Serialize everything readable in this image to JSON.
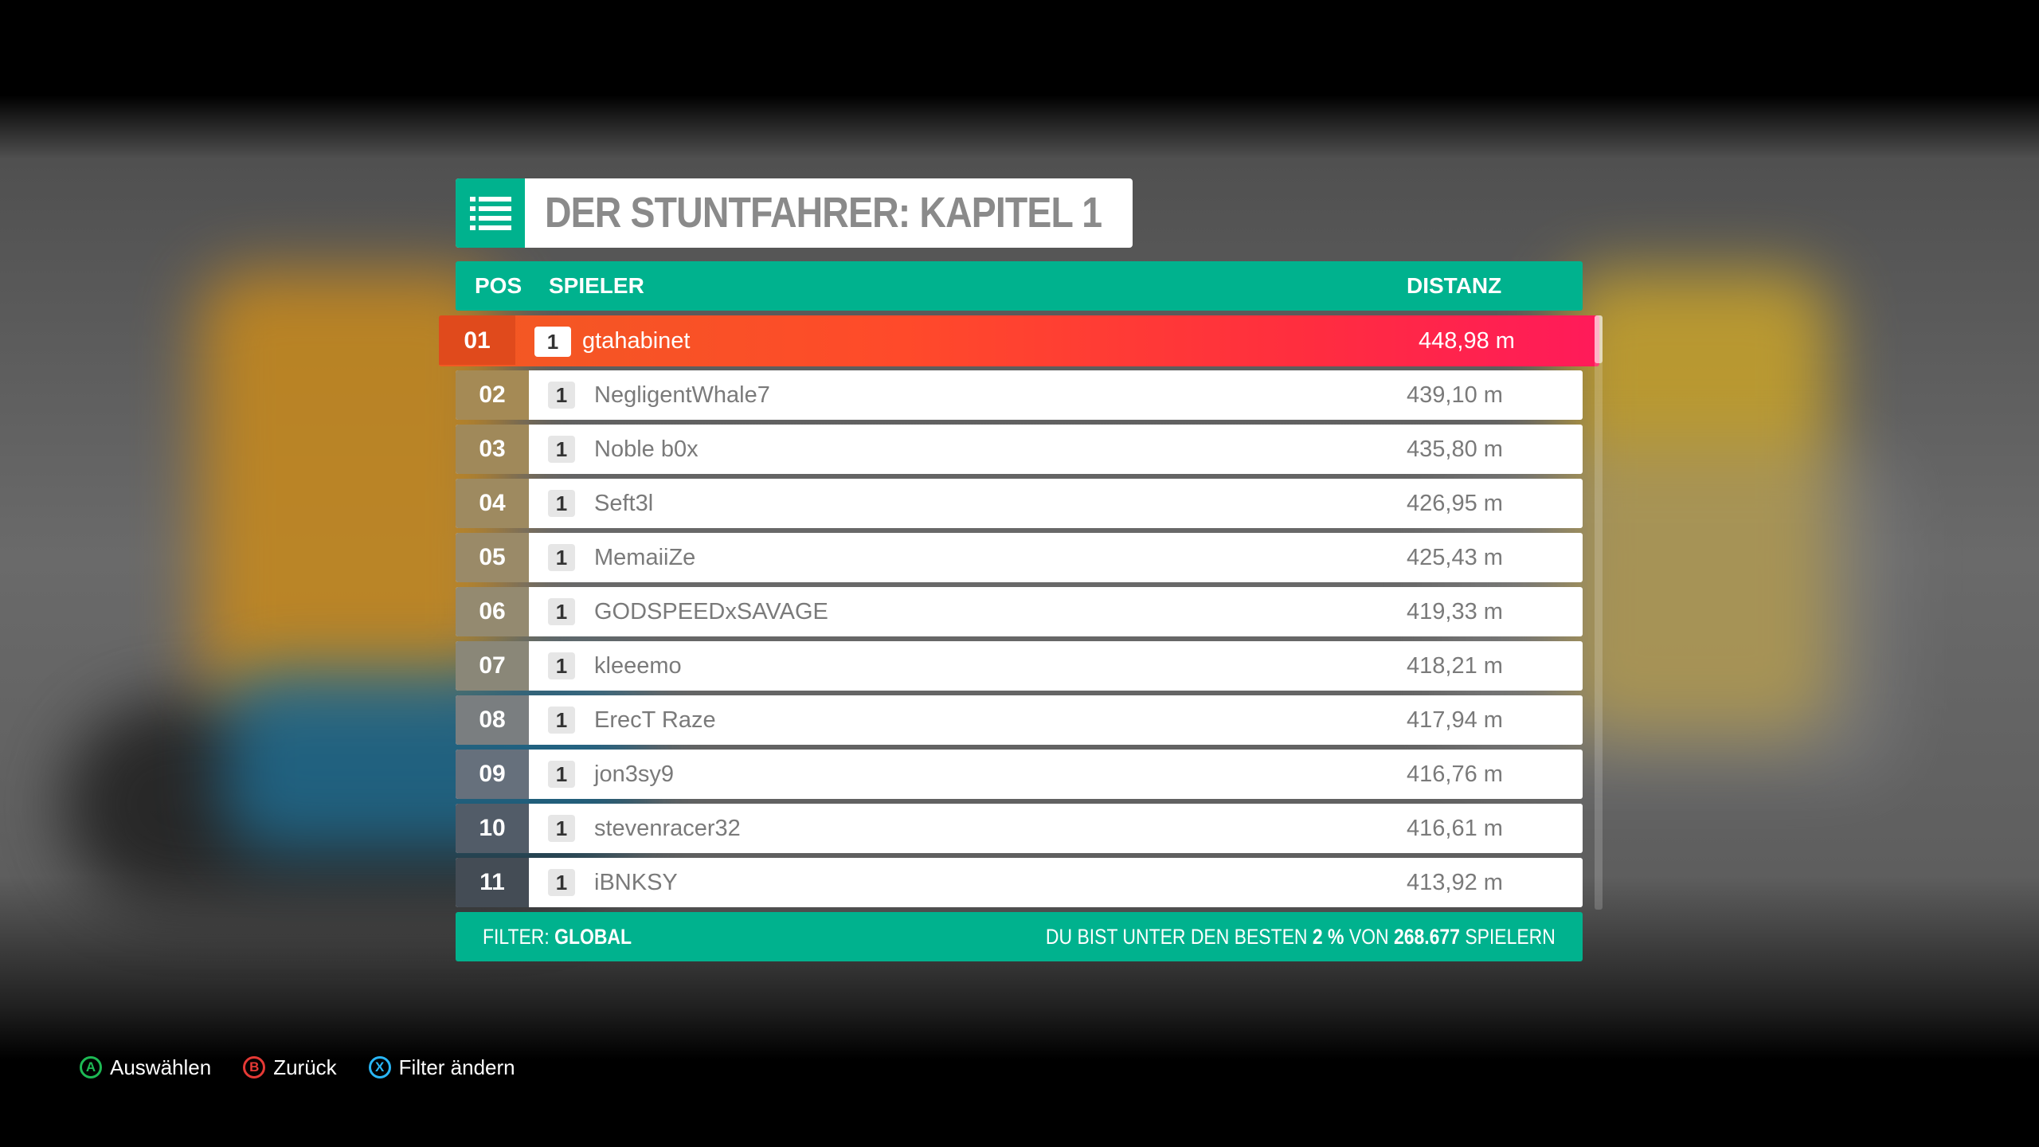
{
  "title": "DER STUNTFAHRER: KAPITEL 1",
  "title_icon": "list-icon",
  "columns": {
    "pos": "POS",
    "player": "SPIELER",
    "distance": "DISTANZ"
  },
  "rows": [
    {
      "pos": "01",
      "rank": "1",
      "player": "gtahabinet",
      "distance": "448,98 m",
      "highlighted": true
    },
    {
      "pos": "02",
      "rank": "1",
      "player": "NegligentWhale7",
      "distance": "439,10 m"
    },
    {
      "pos": "03",
      "rank": "1",
      "player": "Noble b0x",
      "distance": "435,80 m"
    },
    {
      "pos": "04",
      "rank": "1",
      "player": "Seft3l",
      "distance": "426,95 m"
    },
    {
      "pos": "05",
      "rank": "1",
      "player": "MemaiiZe",
      "distance": "425,43 m"
    },
    {
      "pos": "06",
      "rank": "1",
      "player": "GODSPEEDxSAVAGE",
      "distance": "419,33 m"
    },
    {
      "pos": "07",
      "rank": "1",
      "player": "kleeemo",
      "distance": "418,21 m"
    },
    {
      "pos": "08",
      "rank": "1",
      "player": "ErecT Raze",
      "distance": "417,94 m"
    },
    {
      "pos": "09",
      "rank": "1",
      "player": "jon3sy9",
      "distance": "416,76 m"
    },
    {
      "pos": "10",
      "rank": "1",
      "player": "stevenracer32",
      "distance": "416,61 m"
    },
    {
      "pos": "11",
      "rank": "1",
      "player": "iBNKSY",
      "distance": "413,92 m"
    }
  ],
  "footer": {
    "filter_label": "FILTER:",
    "filter_value": "GLOBAL",
    "stat_prefix": "DU BIST UNTER DEN BESTEN",
    "stat_percent": "2 %",
    "stat_mid": "VON",
    "stat_count": "268.677",
    "stat_suffix": "SPIELERN"
  },
  "hints": [
    {
      "glyph": "A",
      "label": "Auswählen",
      "color": "#1db954",
      "icon": "a-button-icon"
    },
    {
      "glyph": "B",
      "label": "Zurück",
      "color": "#e53935",
      "icon": "b-button-icon"
    },
    {
      "glyph": "X",
      "label": "Filter ändern",
      "color": "#29b6f6",
      "icon": "x-button-icon"
    }
  ],
  "colors": {
    "accent": "#00b28e",
    "highlight_start": "#f15a22",
    "highlight_end": "#ff1a5a",
    "pos_gradient": [
      "#a58a55",
      "#a0895a",
      "#9e8a60",
      "#9a8a68",
      "#948a70",
      "#8a8778",
      "#7a7e80",
      "#66707c",
      "#525c68",
      "#444c55"
    ]
  }
}
